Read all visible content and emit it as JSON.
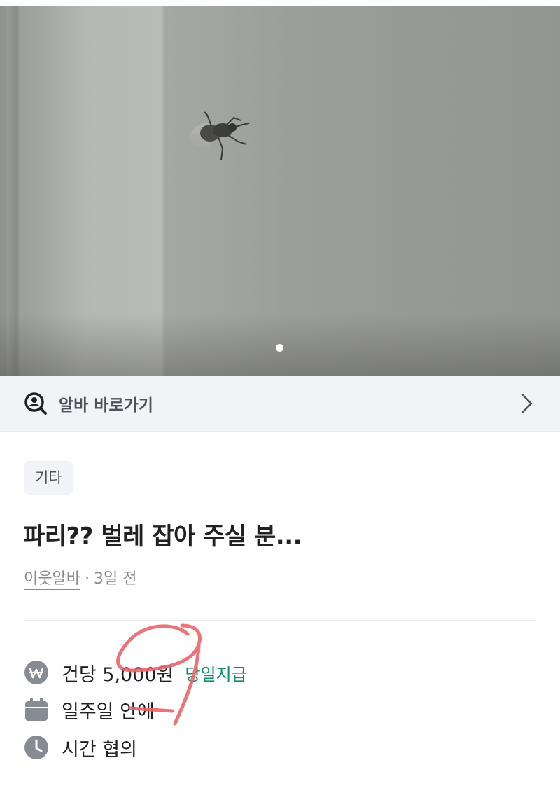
{
  "photo": {
    "pager_total": 1,
    "pager_current": 1
  },
  "shortcut": {
    "label": "알바 바로가기"
  },
  "post": {
    "category": "기타",
    "title": "파리?? 벌레 잡아 주실 분...",
    "author": "이웃알바",
    "separator": "·",
    "posted_ago": "3일 전"
  },
  "details": {
    "pay": "건당 5,000원",
    "pay_badge": "당일지급",
    "period": "일주일 안에",
    "time": "시간 협의"
  },
  "colors": {
    "accent_green": "#0a8f6a",
    "icon_gray": "#868b94",
    "annotation_red": "#e9656a"
  }
}
